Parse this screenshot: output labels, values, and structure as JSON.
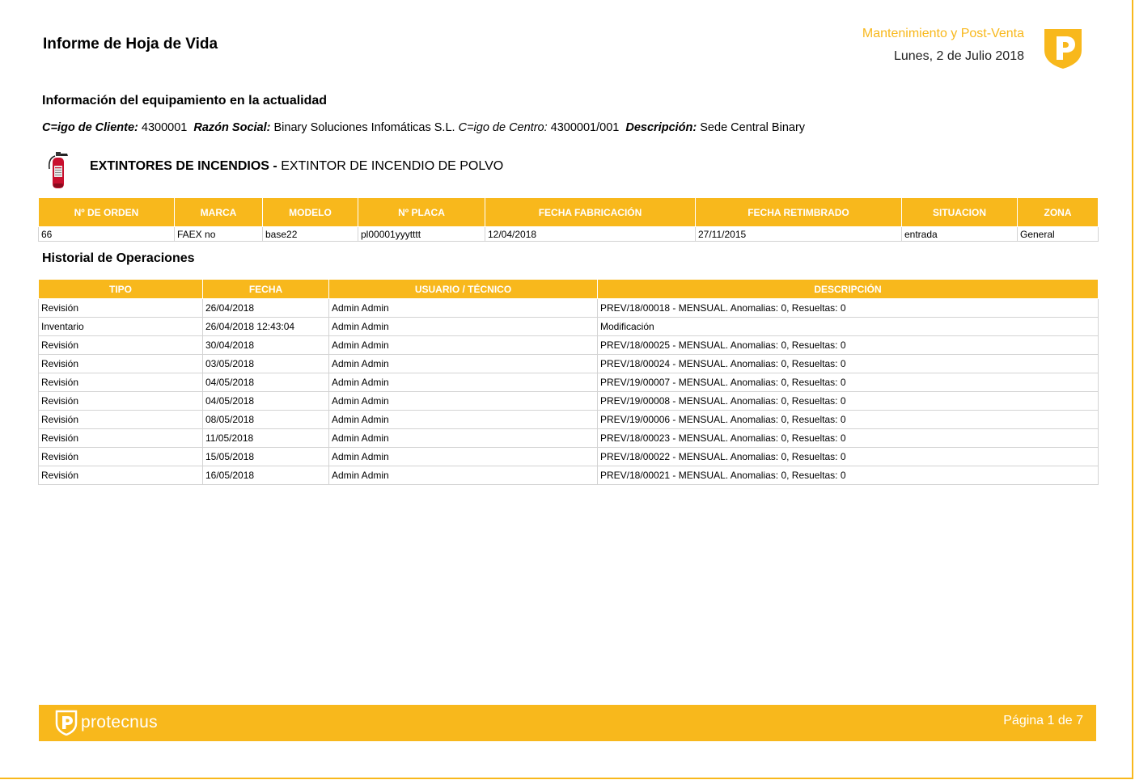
{
  "header": {
    "title": "Informe de Hoja de Vida",
    "department": "Mantenimiento y Post-Venta",
    "date": "Lunes, 2 de Julio 2018"
  },
  "section_equipment_title": "Información del equipamiento en la actualidad",
  "client": {
    "code_label": "C=igo de Cliente:",
    "code_value": "4300001",
    "razon_label": "Razón Social:",
    "razon_value": "Binary Soluciones Infomáticas S.L.",
    "centro_label": "C=igo de Centro:",
    "centro_value": "4300001/001",
    "desc_label": "Descripción:",
    "desc_value": "Sede Central Binary"
  },
  "equipment": {
    "category": "EXTINTORES DE INCENDIOS -",
    "name": "EXTINTOR  DE INCENDIO DE POLVO",
    "columns": [
      "Nº DE ORDEN",
      "MARCA",
      "MODELO",
      "Nº PLACA",
      "FECHA FABRICACIÓN",
      "FECHA RETIMBRADO",
      "SITUACION",
      "ZONA"
    ],
    "row": [
      "66",
      "FAEX no",
      "base22",
      "pl00001yyytttt",
      "12/04/2018",
      "27/11/2015",
      "entrada",
      "General"
    ]
  },
  "history": {
    "title": "Historial de Operaciones",
    "columns": [
      "TIPO",
      "FECHA",
      "USUARIO / TÉCNICO",
      "DESCRIPCIÓN"
    ],
    "rows": [
      [
        "Revisión",
        "26/04/2018",
        "Admin Admin",
        "PREV/18/00018 - MENSUAL. Anomalias: 0, Resueltas: 0"
      ],
      [
        "Inventario",
        "26/04/2018 12:43:04",
        "Admin Admin",
        "Modificación"
      ],
      [
        "Revisión",
        "30/04/2018",
        "Admin Admin",
        "PREV/18/00025 - MENSUAL. Anomalias: 0, Resueltas: 0"
      ],
      [
        "Revisión",
        "03/05/2018",
        "Admin Admin",
        "PREV/18/00024 - MENSUAL. Anomalias: 0, Resueltas: 0"
      ],
      [
        "Revisión",
        "04/05/2018",
        "Admin Admin",
        "PREV/19/00007 - MENSUAL. Anomalias: 0, Resueltas: 0"
      ],
      [
        "Revisión",
        "04/05/2018",
        "Admin Admin",
        "PREV/19/00008 - MENSUAL. Anomalias: 0, Resueltas: 0"
      ],
      [
        "Revisión",
        "08/05/2018",
        "Admin Admin",
        "PREV/19/00006 - MENSUAL. Anomalias: 0, Resueltas: 0"
      ],
      [
        "Revisión",
        "11/05/2018",
        "Admin Admin",
        "PREV/18/00023 - MENSUAL. Anomalias: 0, Resueltas: 0"
      ],
      [
        "Revisión",
        "15/05/2018",
        "Admin Admin",
        "PREV/18/00022 - MENSUAL. Anomalias: 0, Resueltas: 0"
      ],
      [
        "Revisión",
        "16/05/2018",
        "Admin Admin",
        "PREV/18/00021 - MENSUAL. Anomalias: 0, Resueltas: 0"
      ]
    ]
  },
  "footer": {
    "brand": "protecnus",
    "page": "Página 1 de 7"
  },
  "icons": {
    "logo": "protecnus-p-logo-icon",
    "equipment": "fire-extinguisher-icon"
  },
  "colors": {
    "accent": "#f8b81c",
    "extinguisher": "#c8102e"
  }
}
